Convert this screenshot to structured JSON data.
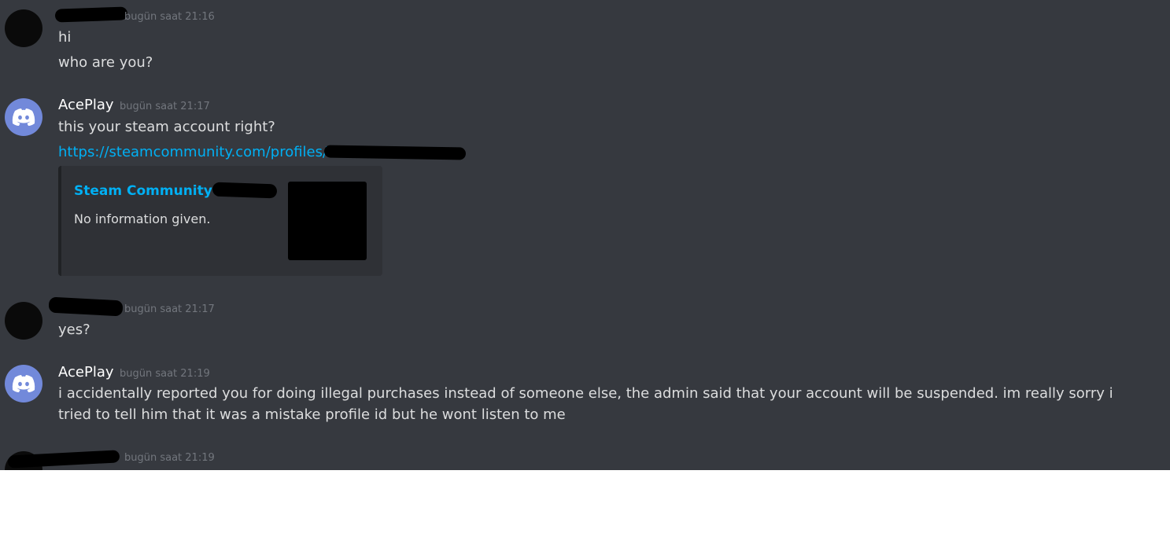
{
  "messages": [
    {
      "username": "",
      "timestamp": "bugün saat 21:16",
      "lines": [
        "hi",
        "who are you?"
      ]
    },
    {
      "username": "AcePlay",
      "timestamp": "bugün saat 21:17",
      "lines": [
        "this your steam account right?"
      ],
      "link": "https://steamcommunity.com/profiles/7",
      "embed": {
        "title": "Steam Community :: St",
        "description": "No information given."
      }
    },
    {
      "username": "",
      "timestamp": "bugün saat 21:17",
      "lines": [
        "yes?"
      ]
    },
    {
      "username": "AcePlay",
      "timestamp": "bugün saat 21:19",
      "lines": [
        "i accidentally reported you for doing illegal purchases instead of someone else, the admin said that your account will be suspended. im really sorry i tried to tell him that it was a mistake profile id but he wont listen to me"
      ]
    },
    {
      "username": "",
      "timestamp": "bugün saat 21:19",
      "lines": []
    }
  ],
  "colors": {
    "background": "#36393f",
    "link": "#00b0f4",
    "discord_avatar": "#7289da",
    "embed_bg": "#2f3136"
  },
  "icons": {
    "bot_avatar": "discord-logo-icon"
  }
}
